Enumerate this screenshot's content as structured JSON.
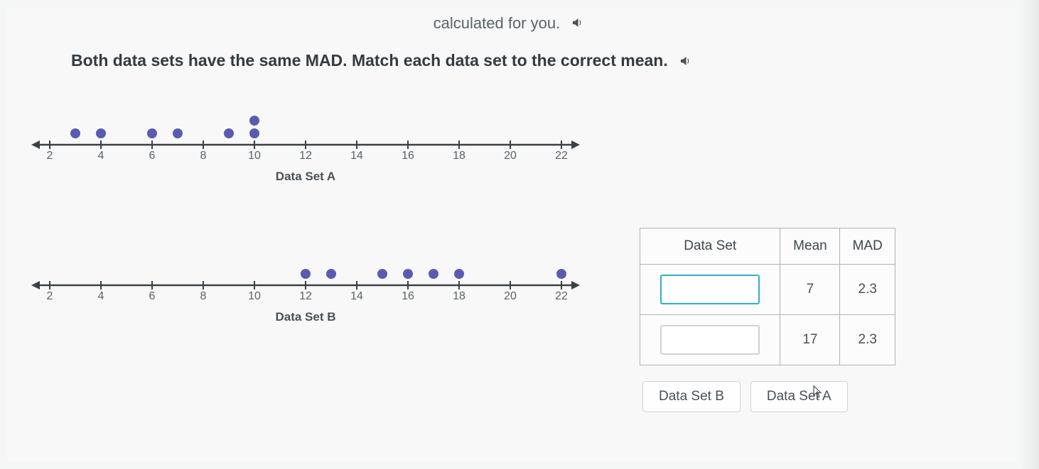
{
  "top_partial_text": "calculated for you.",
  "instruction_text": "Both data sets have the same MAD. Match each data set to the correct mean.",
  "chart_data": [
    {
      "type": "dotplot",
      "label": "Data Set A",
      "axis": {
        "min": 2,
        "max": 22,
        "step": 2,
        "ticks": [
          2,
          4,
          6,
          8,
          10,
          12,
          14,
          16,
          18,
          20,
          22
        ]
      },
      "values": [
        3,
        4,
        6,
        7,
        9,
        10,
        10
      ]
    },
    {
      "type": "dotplot",
      "label": "Data Set B",
      "axis": {
        "min": 2,
        "max": 22,
        "step": 2,
        "ticks": [
          2,
          4,
          6,
          8,
          10,
          12,
          14,
          16,
          18,
          20,
          22
        ]
      },
      "values": [
        12,
        13,
        15,
        16,
        17,
        18,
        22
      ]
    }
  ],
  "table": {
    "headers": {
      "col1": "Data Set",
      "col2": "Mean",
      "col3": "MAD"
    },
    "rows": [
      {
        "dataset": "",
        "mean": "7",
        "mad": "2.3",
        "active": true
      },
      {
        "dataset": "",
        "mean": "17",
        "mad": "2.3",
        "active": false
      }
    ]
  },
  "drag_tiles": {
    "tile1": "Data Set B",
    "tile2": "Data Set A"
  }
}
